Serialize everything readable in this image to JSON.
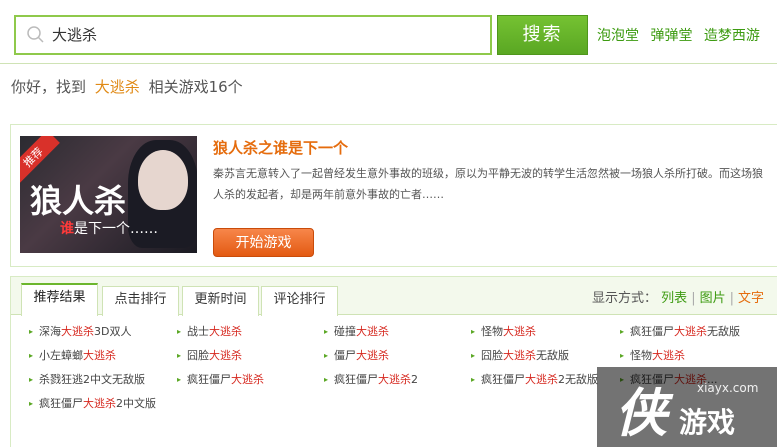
{
  "search": {
    "query": "大逃杀",
    "button_label": "搜索",
    "quick_links": [
      "泡泡堂",
      "弹弹堂",
      "造梦西游"
    ]
  },
  "summary": {
    "prefix": "你好，找到",
    "keyword": "大逃杀",
    "suffix": "相关游戏16个"
  },
  "featured": {
    "badge": "推荐",
    "thumb_title": "狼人杀",
    "thumb_sub_accent": "谁",
    "thumb_sub_rest": "是下一个……",
    "title": "狼人杀之谁是下一个",
    "description": "秦苏言无意转入了一起曾经发生意外事故的班级，原以为平静无波的转学生活忽然被一场狼人杀所打破。而这场狼人杀的发起者，却是两年前意外事故的亡者……",
    "play_label": "开始游戏"
  },
  "tabs": [
    "推荐结果",
    "点击排行",
    "更新时间",
    "评论排行"
  ],
  "view_mode": {
    "label": "显示方式：",
    "options": [
      "列表",
      "图片",
      "文字"
    ],
    "active": "文字"
  },
  "results": [
    [
      {
        "pre": "深海",
        "hl": "大逃杀",
        "post": "3D双人"
      },
      {
        "pre": "战士",
        "hl": "大逃杀",
        "post": ""
      },
      {
        "pre": "碰撞",
        "hl": "大逃杀",
        "post": ""
      },
      {
        "pre": "怪物",
        "hl": "大逃杀",
        "post": ""
      },
      {
        "pre": "疯狂僵尸",
        "hl": "大逃杀",
        "post": "无敌版"
      }
    ],
    [
      {
        "pre": "小左蟑螂",
        "hl": "大逃杀",
        "post": ""
      },
      {
        "pre": "囧脸",
        "hl": "大逃杀",
        "post": ""
      },
      {
        "pre": "僵尸",
        "hl": "大逃杀",
        "post": ""
      },
      {
        "pre": "囧脸",
        "hl": "大逃杀",
        "post": "无敌版"
      },
      {
        "pre": "怪物",
        "hl": "大逃杀",
        "post": ""
      }
    ],
    [
      {
        "pre": "杀戮狂逃2中文无敌版",
        "hl": "",
        "post": ""
      },
      {
        "pre": "疯狂僵尸",
        "hl": "大逃杀",
        "post": ""
      },
      {
        "pre": "疯狂僵尸",
        "hl": "大逃杀",
        "post": "2"
      },
      {
        "pre": "疯狂僵尸",
        "hl": "大逃杀",
        "post": "2无敌版"
      },
      {
        "pre": "疯狂僵尸",
        "hl": "大逃杀",
        "post": "..."
      }
    ],
    [
      {
        "pre": "疯狂僵尸",
        "hl": "大逃杀",
        "post": "2中文版"
      }
    ]
  ],
  "watermark": {
    "logo": "侠",
    "text": "游戏",
    "url": "xiayx.com"
  },
  "colors": {
    "brand_green": "#5aa723",
    "highlight_orange": "#e56c0d",
    "keyword_red": "#d6281f"
  }
}
